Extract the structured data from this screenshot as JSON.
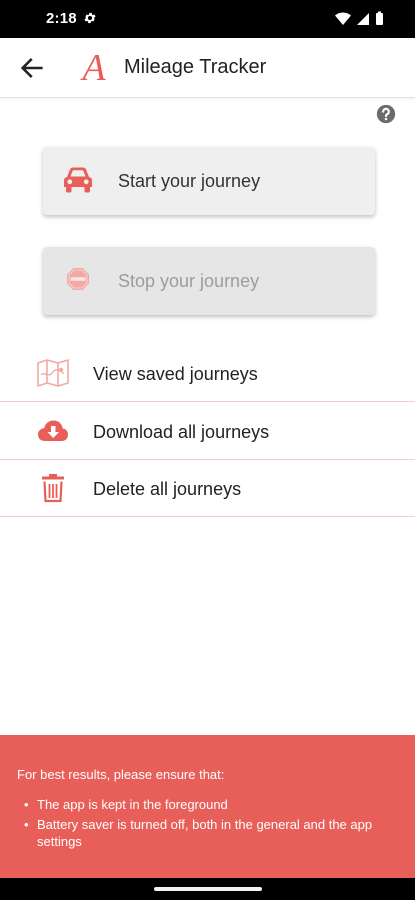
{
  "status_bar": {
    "time": "2:18",
    "icons": [
      "settings-gear-icon",
      "wifi-icon",
      "cellular-signal-icon",
      "battery-icon"
    ]
  },
  "toolbar": {
    "title": "Mileage Tracker",
    "back_icon": "arrow-left-icon",
    "logo_letter": "A"
  },
  "help_icon": "question-circle-icon",
  "buttons": {
    "start": {
      "label": "Start your journey",
      "icon": "car-icon"
    },
    "stop": {
      "label": "Stop your journey",
      "icon": "stop-sign-icon",
      "disabled": true
    }
  },
  "menu": [
    {
      "label": "View saved journeys",
      "icon": "map-icon"
    },
    {
      "label": "Download all journeys",
      "icon": "cloud-download-icon"
    },
    {
      "label": "Delete all journeys",
      "icon": "trash-icon"
    }
  ],
  "info": {
    "title": "For best results, please ensure that:",
    "bullets": [
      "The app is kept in the foreground",
      "Battery saver is turned off, both in the general and the app settings"
    ]
  },
  "colors": {
    "accent": "#e85f5a",
    "divider": "#f3cdca",
    "button_bg": "#efefef",
    "disabled_text": "#9c9c9c"
  }
}
